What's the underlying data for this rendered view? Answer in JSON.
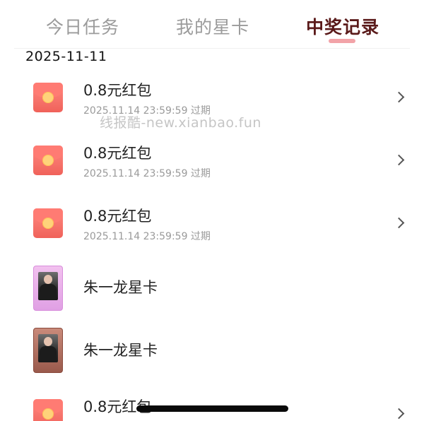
{
  "tabs": [
    {
      "label": "今日任务",
      "active": false
    },
    {
      "label": "我的星卡",
      "active": false
    },
    {
      "label": "中奖记录",
      "active": true
    }
  ],
  "date_header": "2025-11-11",
  "watermark": "线报酷-new.xianbao.fun",
  "items": [
    {
      "type": "red-packet",
      "title": "0.8元红包",
      "subtitle": "2025.11.14 23:59:59 过期",
      "icon": "red-envelope-icon"
    },
    {
      "type": "red-packet",
      "title": "0.8元红包",
      "subtitle": "2025.11.14 23:59:59 过期",
      "icon": "red-envelope-icon"
    },
    {
      "type": "red-packet",
      "title": "0.8元红包",
      "subtitle": "2025.11.14 23:59:59 过期",
      "icon": "red-envelope-icon"
    },
    {
      "type": "star-card",
      "title": "朱一龙星卡",
      "icon": "star-card-icon"
    },
    {
      "type": "star-card",
      "title": "朱一龙星卡",
      "icon": "star-card-icon"
    },
    {
      "type": "red-packet",
      "title": "0.8元红包",
      "icon": "red-envelope-icon"
    }
  ],
  "colors": {
    "active_tab": "#5a1a1a",
    "inactive_tab": "#9b9b9b",
    "tab_indicator": "#f2a3a8",
    "envelope": "#f0625a",
    "coin": "#ffd27a"
  }
}
